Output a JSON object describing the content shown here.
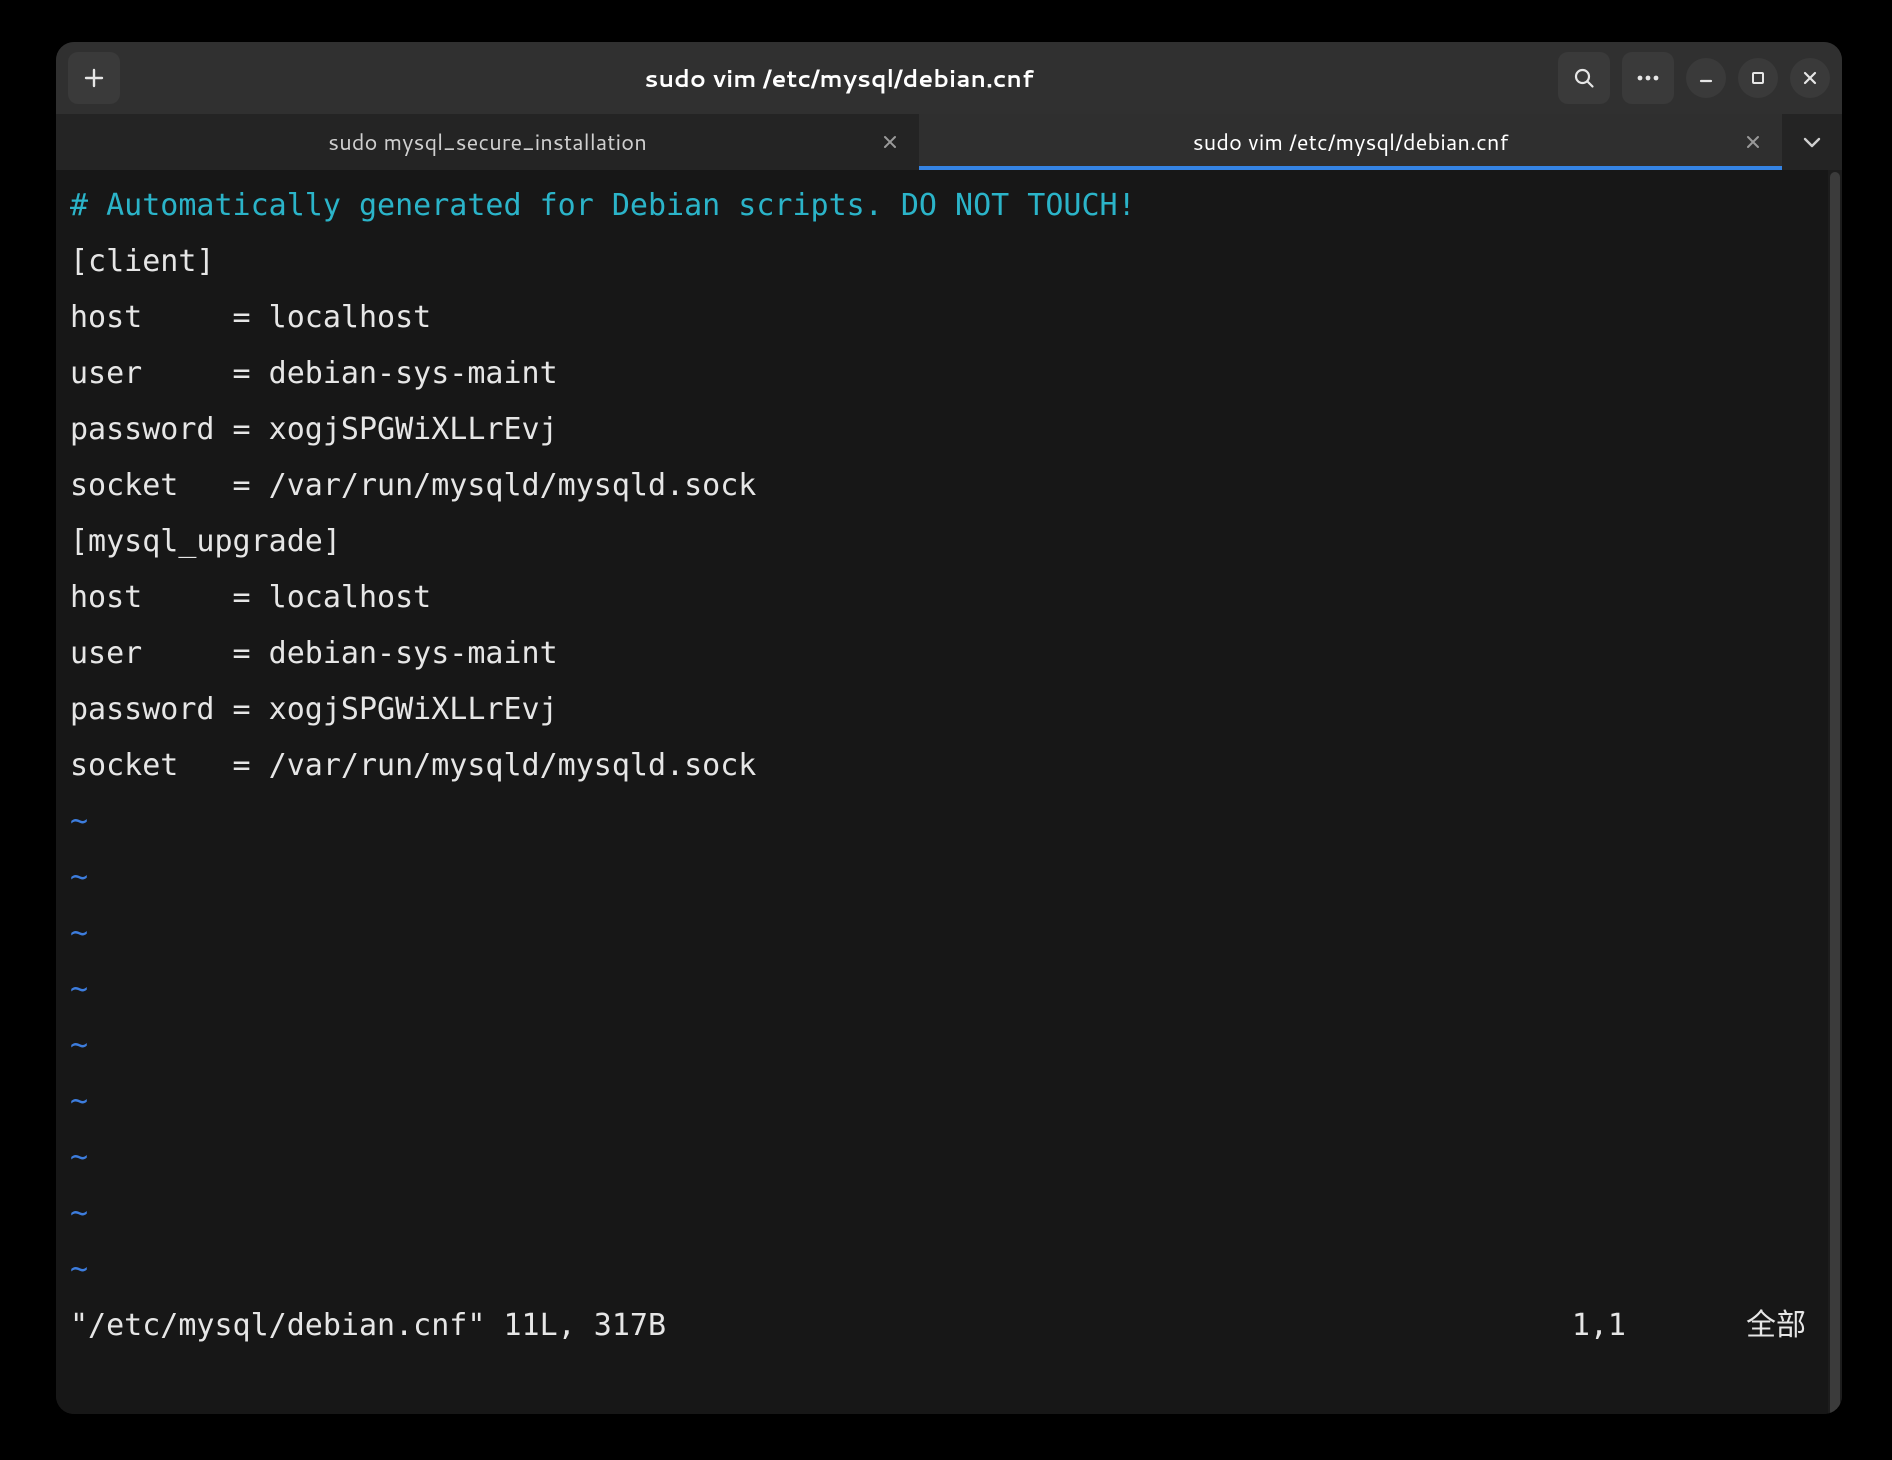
{
  "header": {
    "title": "sudo vim /etc/mysql/debian.cnf"
  },
  "tabs": [
    {
      "label": "sudo mysql_secure_installation",
      "active": false
    },
    {
      "label": "sudo vim /etc/mysql/debian.cnf",
      "active": true
    }
  ],
  "editor": {
    "comment_line": "# Automatically generated for Debian scripts. DO NOT TOUCH!",
    "lines": [
      "[client]",
      "host     = localhost",
      "user     = debian-sys-maint",
      "password = xogjSPGWiXLLrEvj",
      "socket   = /var/run/mysqld/mysqld.sock",
      "[mysql_upgrade]",
      "host     = localhost",
      "user     = debian-sys-maint",
      "password = xogjSPGWiXLLrEvj",
      "socket   = /var/run/mysqld/mysqld.sock"
    ],
    "tilde": "~",
    "tilde_count": 9
  },
  "status": {
    "left": "\"/etc/mysql/debian.cnf\" 11L, 317B",
    "position": "1,1",
    "percent": "全部"
  }
}
